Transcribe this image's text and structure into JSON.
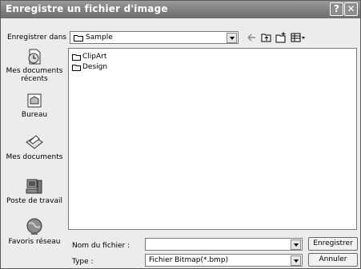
{
  "window": {
    "title": "Enregistre un fichier d'image"
  },
  "titlebar": {
    "help_label": "?",
    "close_label": "✕"
  },
  "location": {
    "label": "Enregistrer dans :",
    "value": "Sample"
  },
  "places": [
    {
      "label": "Mes documents récents",
      "icon": "recent-documents-icon"
    },
    {
      "label": "Bureau",
      "icon": "desktop-icon"
    },
    {
      "label": "Mes documents",
      "icon": "my-documents-icon"
    },
    {
      "label": "Poste de travail",
      "icon": "my-computer-icon"
    },
    {
      "label": "Favoris réseau",
      "icon": "network-places-icon"
    }
  ],
  "files": [
    {
      "name": "ClipArt",
      "type": "folder"
    },
    {
      "name": "Design",
      "type": "folder"
    }
  ],
  "filename": {
    "label": "Nom du fichier :",
    "value": ""
  },
  "filetype": {
    "label": "Type :",
    "value": "Fichier Bitmap(*.bmp)"
  },
  "buttons": {
    "save": "Enregistrer",
    "cancel": "Annuler"
  }
}
